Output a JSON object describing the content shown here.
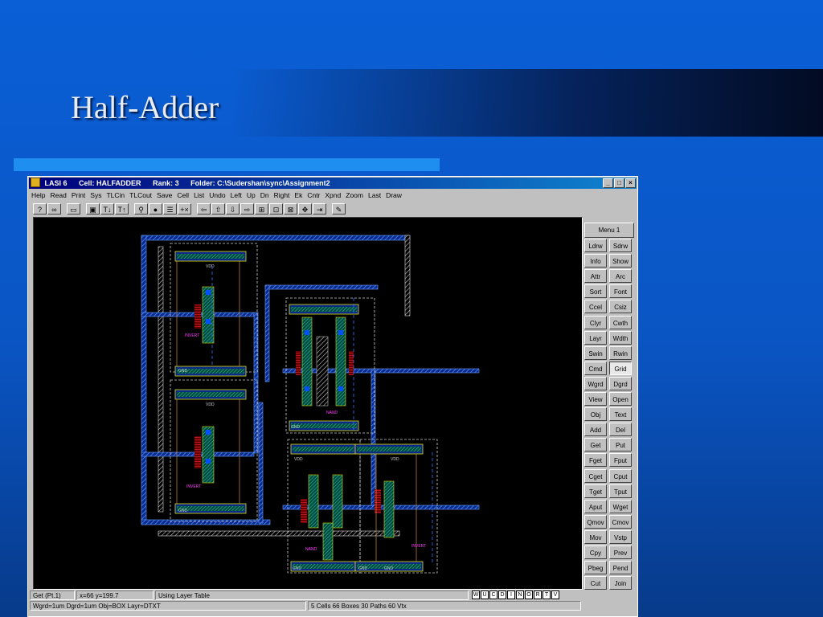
{
  "slide": {
    "title": "Half-Adder"
  },
  "window": {
    "app": "LASI 6",
    "cell": "Cell: HALFADDER",
    "rank": "Rank: 3",
    "folder": "Folder: C:\\Sudershan\\sync\\Assignment2",
    "btn_minimize": "_",
    "btn_maximize": "□",
    "btn_close": "×"
  },
  "menu": [
    "Help",
    "Read",
    "Print",
    "Sys",
    "TLCin",
    "TLCout",
    "Save",
    "Cell",
    "List",
    "Undo",
    "Left",
    "Up",
    "Dn",
    "Right",
    "Ek",
    "Cntr",
    "Xpnd",
    "Zoom",
    "Last",
    "Draw"
  ],
  "toolbar": {
    "help": "?",
    "glasses": "∞",
    "cell": "▭",
    "print": "▣",
    "tlc_in": "T↓",
    "tlc_out": "T↑",
    "zoom": "⚲",
    "layers": "●",
    "list": "☰",
    "cross": "+×",
    "left": "⇦",
    "up": "⇧",
    "down": "⇩",
    "right": "⇨",
    "fit": "⊞",
    "center": "⊡",
    "expand": "⊠",
    "move": "✥",
    "last": "⇥",
    "draw": "✎"
  },
  "panel": {
    "menu1": "Menu 1",
    "buttons": [
      [
        "Ldrw",
        "Sdrw"
      ],
      [
        "Info",
        "Show"
      ],
      [
        "Attr",
        "Arc"
      ],
      [
        "Sort",
        "Font"
      ],
      [
        "Ccel",
        "Csiz"
      ],
      [
        "Clyr",
        "Cwth"
      ],
      [
        "Layr",
        "Wdth"
      ],
      [
        "Swin",
        "Rwin"
      ],
      [
        "Cmd",
        "Grid"
      ],
      [
        "Wgrd",
        "Dgrd"
      ],
      [
        "View",
        "Open"
      ],
      [
        "Obj",
        "Text"
      ],
      [
        "Add",
        "Del"
      ],
      [
        "Get",
        "Put"
      ],
      [
        "Fget",
        "Fput"
      ],
      [
        "Cget",
        "Cput"
      ],
      [
        "Tget",
        "Tput"
      ],
      [
        "Aput",
        "Wget"
      ],
      [
        "Qmov",
        "Cmov"
      ],
      [
        "Mov",
        "Vstp"
      ],
      [
        "Cpy",
        "Prev"
      ],
      [
        "Pbeg",
        "Pend"
      ],
      [
        "Cut",
        "Join"
      ]
    ]
  },
  "status": {
    "command": "Get (Pt.1)",
    "coords": "x=66  y=199.7",
    "message": "Using Layer Table",
    "settings": "Wgrd=1um  Dgrd=1um  Obj=BOX  Layr=DTXT",
    "counts": "5 Cells  66 Boxes  30 Paths  60 Vtx",
    "flags": [
      "W",
      "U",
      "C",
      "D",
      "I",
      "N",
      "O",
      "R",
      "T",
      "V"
    ]
  },
  "labels": {
    "vdd1": "VDD",
    "vdd2": "VDD",
    "vdd3": "VDD",
    "vdd4": "VDD",
    "gnd1": "GND",
    "gnd2": "GND",
    "gnd3": "GND",
    "gnd4": "GND",
    "gnd5": "GND",
    "gnd6": "GND",
    "inv1": "INVERT",
    "inv2": "INVERT",
    "nand1": "NAND",
    "nand2": "NAND",
    "inv3": "INVERT"
  }
}
